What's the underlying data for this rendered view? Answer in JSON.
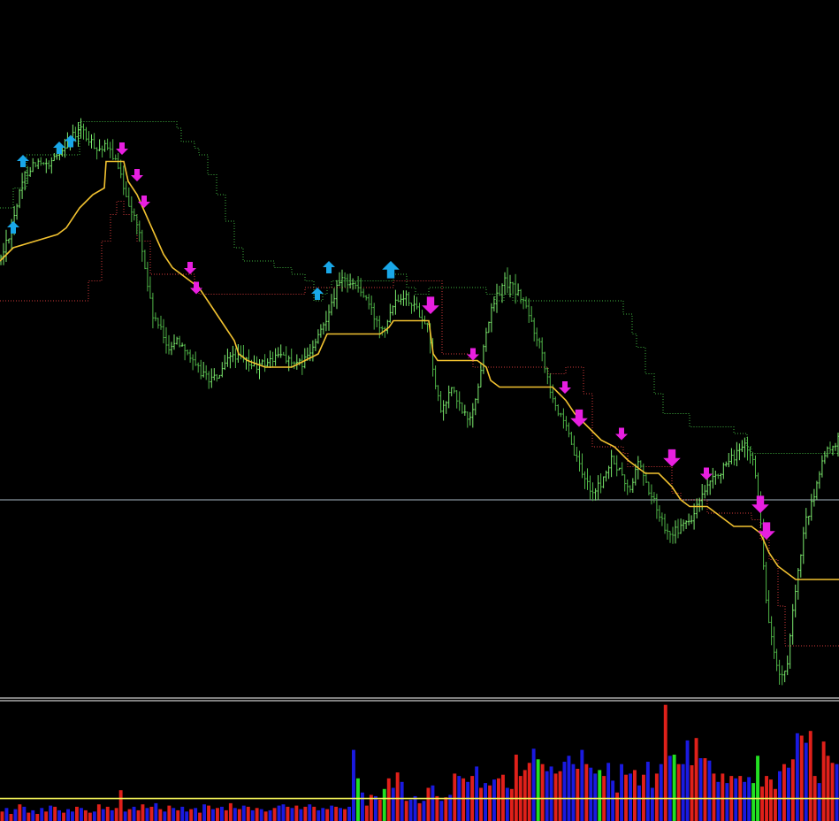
{
  "colors": {
    "background": "#000000",
    "price_bar": "#7CEB6E",
    "price_bar_dark": "#4FB548",
    "upper_channel": "#3FB53F",
    "lower_channel": "#D23A3A",
    "middle_line": "#F2C230",
    "horizontal_level": "#A9B8C4",
    "separator": "#FFFFFF",
    "arrow_up": "#19A7E8",
    "arrow_down": "#E81FE0",
    "volume_up": "#1A1AE0",
    "volume_down": "#E0201A",
    "volume_spike": "#22E022",
    "volume_average": "#F5F55A"
  },
  "chart_data": [
    {
      "type": "candlestick",
      "title": "",
      "xlabel": "",
      "ylabel": "",
      "ylim": [
        0,
        100
      ],
      "x_count": 190,
      "price_path": [
        [
          0,
          66
        ],
        [
          10,
          70
        ],
        [
          18,
          74
        ],
        [
          28,
          79
        ],
        [
          40,
          81
        ],
        [
          55,
          80
        ],
        [
          65,
          82
        ],
        [
          75,
          84
        ],
        [
          85,
          85
        ],
        [
          92,
          86
        ],
        [
          100,
          84
        ],
        [
          112,
          83
        ],
        [
          120,
          83
        ],
        [
          128,
          82
        ],
        [
          138,
          78
        ],
        [
          148,
          74
        ],
        [
          158,
          70
        ],
        [
          165,
          64
        ],
        [
          172,
          58
        ],
        [
          180,
          56
        ],
        [
          190,
          53
        ],
        [
          200,
          54
        ],
        [
          210,
          53
        ],
        [
          220,
          50
        ],
        [
          230,
          49
        ],
        [
          240,
          48
        ],
        [
          250,
          49
        ],
        [
          262,
          52
        ],
        [
          275,
          51
        ],
        [
          290,
          50
        ],
        [
          305,
          51
        ],
        [
          320,
          52
        ],
        [
          335,
          50
        ],
        [
          345,
          51
        ],
        [
          355,
          53
        ],
        [
          365,
          56
        ],
        [
          375,
          60
        ],
        [
          385,
          63
        ],
        [
          395,
          63
        ],
        [
          405,
          62
        ],
        [
          415,
          60
        ],
        [
          425,
          57
        ],
        [
          435,
          56
        ],
        [
          445,
          60
        ],
        [
          455,
          61
        ],
        [
          465,
          60
        ],
        [
          475,
          58
        ],
        [
          485,
          56
        ],
        [
          492,
          47
        ],
        [
          500,
          43
        ],
        [
          510,
          47
        ],
        [
          520,
          44
        ],
        [
          530,
          42
        ],
        [
          540,
          46
        ],
        [
          550,
          56
        ],
        [
          560,
          60
        ],
        [
          570,
          63
        ],
        [
          580,
          62
        ],
        [
          592,
          60
        ],
        [
          603,
          56
        ],
        [
          612,
          53
        ],
        [
          622,
          47
        ],
        [
          632,
          43
        ],
        [
          642,
          40
        ],
        [
          652,
          36
        ],
        [
          662,
          33
        ],
        [
          672,
          31
        ],
        [
          682,
          33
        ],
        [
          692,
          36
        ],
        [
          702,
          34
        ],
        [
          712,
          31
        ],
        [
          722,
          36
        ],
        [
          732,
          32
        ],
        [
          742,
          29
        ],
        [
          752,
          26
        ],
        [
          762,
          25
        ],
        [
          772,
          26
        ],
        [
          782,
          27
        ],
        [
          792,
          30
        ],
        [
          802,
          32
        ],
        [
          812,
          34
        ],
        [
          822,
          35
        ],
        [
          832,
          37
        ],
        [
          842,
          38
        ],
        [
          852,
          36
        ],
        [
          860,
          28
        ],
        [
          866,
          15
        ],
        [
          872,
          10
        ],
        [
          878,
          5
        ],
        [
          884,
          3
        ],
        [
          890,
          4
        ],
        [
          896,
          12
        ],
        [
          902,
          18
        ],
        [
          910,
          26
        ],
        [
          920,
          30
        ],
        [
          930,
          36
        ],
        [
          940,
          38
        ],
        [
          949,
          39
        ]
      ],
      "upper_channel": [
        [
          0,
          74
        ],
        [
          15,
          77
        ],
        [
          30,
          82
        ],
        [
          90,
          87
        ],
        [
          190,
          87
        ],
        [
          200,
          86
        ],
        [
          205,
          84
        ],
        [
          220,
          83
        ],
        [
          225,
          82
        ],
        [
          235,
          79
        ],
        [
          245,
          76
        ],
        [
          255,
          72
        ],
        [
          265,
          68
        ],
        [
          275,
          66
        ],
        [
          300,
          66
        ],
        [
          310,
          65
        ],
        [
          330,
          64
        ],
        [
          345,
          63
        ],
        [
          355,
          60
        ],
        [
          365,
          61
        ],
        [
          370,
          62
        ],
        [
          375,
          63
        ],
        [
          440,
          63
        ],
        [
          445,
          64
        ],
        [
          460,
          62
        ],
        [
          470,
          61
        ],
        [
          485,
          62
        ],
        [
          545,
          62
        ],
        [
          550,
          61
        ],
        [
          560,
          60
        ],
        [
          570,
          61
        ],
        [
          580,
          60
        ],
        [
          600,
          60
        ],
        [
          690,
          60
        ],
        [
          705,
          58
        ],
        [
          715,
          55
        ],
        [
          720,
          53
        ],
        [
          730,
          49
        ],
        [
          740,
          46
        ],
        [
          750,
          43
        ],
        [
          765,
          43
        ],
        [
          780,
          41
        ],
        [
          810,
          41
        ],
        [
          830,
          40
        ],
        [
          845,
          38
        ],
        [
          850,
          37
        ],
        [
          949,
          37
        ]
      ],
      "lower_channel": [
        [
          0,
          60
        ],
        [
          80,
          60
        ],
        [
          100,
          63
        ],
        [
          115,
          69
        ],
        [
          125,
          73
        ],
        [
          132,
          75
        ],
        [
          140,
          73
        ],
        [
          155,
          69
        ],
        [
          170,
          64
        ],
        [
          190,
          64
        ],
        [
          220,
          62
        ],
        [
          225,
          61
        ],
        [
          340,
          61
        ],
        [
          345,
          62
        ],
        [
          395,
          62
        ],
        [
          440,
          62
        ],
        [
          445,
          63
        ],
        [
          490,
          63
        ],
        [
          500,
          52
        ],
        [
          510,
          52
        ],
        [
          530,
          51
        ],
        [
          535,
          50
        ],
        [
          600,
          50
        ],
        [
          620,
          49
        ],
        [
          630,
          49
        ],
        [
          640,
          50
        ],
        [
          660,
          46
        ],
        [
          670,
          38
        ],
        [
          690,
          38
        ],
        [
          705,
          37
        ],
        [
          710,
          35
        ],
        [
          750,
          35
        ],
        [
          760,
          31
        ],
        [
          770,
          30
        ],
        [
          790,
          30
        ],
        [
          800,
          28
        ],
        [
          840,
          28
        ],
        [
          850,
          27
        ],
        [
          860,
          24
        ],
        [
          870,
          21
        ],
        [
          880,
          14
        ],
        [
          888,
          8
        ],
        [
          949,
          8
        ]
      ],
      "middle_line": [
        [
          0,
          66
        ],
        [
          15,
          68
        ],
        [
          40,
          69
        ],
        [
          65,
          70
        ],
        [
          75,
          71
        ],
        [
          90,
          74
        ],
        [
          105,
          76
        ],
        [
          118,
          77
        ],
        [
          120,
          81
        ],
        [
          140,
          81
        ],
        [
          145,
          78
        ],
        [
          155,
          76
        ],
        [
          165,
          73
        ],
        [
          175,
          70
        ],
        [
          185,
          67
        ],
        [
          195,
          65
        ],
        [
          205,
          64
        ],
        [
          215,
          63
        ],
        [
          225,
          62
        ],
        [
          235,
          60
        ],
        [
          245,
          58
        ],
        [
          255,
          56
        ],
        [
          265,
          54
        ],
        [
          270,
          52
        ],
        [
          280,
          51
        ],
        [
          300,
          50
        ],
        [
          315,
          50
        ],
        [
          330,
          50
        ],
        [
          345,
          51
        ],
        [
          360,
          52
        ],
        [
          370,
          55
        ],
        [
          380,
          55
        ],
        [
          430,
          55
        ],
        [
          440,
          56
        ],
        [
          445,
          57
        ],
        [
          485,
          57
        ],
        [
          490,
          52
        ],
        [
          495,
          51
        ],
        [
          540,
          51
        ],
        [
          550,
          50
        ],
        [
          555,
          48
        ],
        [
          565,
          47
        ],
        [
          610,
          47
        ],
        [
          625,
          47
        ],
        [
          640,
          45
        ],
        [
          650,
          43
        ],
        [
          665,
          41
        ],
        [
          680,
          39
        ],
        [
          695,
          38
        ],
        [
          710,
          36
        ],
        [
          720,
          35
        ],
        [
          730,
          34
        ],
        [
          745,
          34
        ],
        [
          760,
          32
        ],
        [
          770,
          30
        ],
        [
          780,
          29
        ],
        [
          800,
          29
        ],
        [
          810,
          28
        ],
        [
          820,
          27
        ],
        [
          830,
          26
        ],
        [
          850,
          26
        ],
        [
          860,
          25
        ],
        [
          870,
          22
        ],
        [
          880,
          20
        ],
        [
          890,
          19
        ],
        [
          900,
          18
        ],
        [
          910,
          18
        ],
        [
          949,
          18
        ]
      ],
      "horizontal_level": 30,
      "arrows_up": [
        [
          15,
          72
        ],
        [
          26,
          82
        ],
        [
          67,
          84
        ],
        [
          80,
          85
        ],
        [
          359,
          62
        ],
        [
          372,
          66
        ],
        [
          442,
          66
        ]
      ],
      "arrows_down": [
        [
          138,
          82
        ],
        [
          155,
          78
        ],
        [
          163,
          74
        ],
        [
          215,
          64
        ],
        [
          222,
          61
        ],
        [
          487,
          58
        ],
        [
          535,
          51
        ],
        [
          639,
          46
        ],
        [
          655,
          41
        ],
        [
          703,
          39
        ],
        [
          760,
          35
        ],
        [
          799,
          33
        ],
        [
          860,
          28
        ],
        [
          867,
          24
        ]
      ]
    },
    {
      "type": "bar",
      "title": "",
      "xlabel": "",
      "ylabel": "",
      "ylim": [
        0,
        100
      ],
      "average_level": 19,
      "values": [
        8,
        11,
        6,
        10,
        14,
        12,
        7,
        9,
        6,
        11,
        8,
        13,
        12,
        9,
        7,
        10,
        8,
        12,
        11,
        9,
        7,
        8,
        14,
        10,
        12,
        9,
        11,
        26,
        8,
        10,
        12,
        9,
        14,
        11,
        12,
        15,
        10,
        8,
        13,
        11,
        9,
        12,
        8,
        10,
        11,
        7,
        14,
        13,
        10,
        11,
        12,
        9,
        15,
        11,
        10,
        13,
        12,
        9,
        11,
        10,
        8,
        9,
        11,
        13,
        14,
        12,
        11,
        13,
        10,
        12,
        14,
        12,
        9,
        11,
        10,
        13,
        12,
        11,
        10,
        12,
        60,
        36,
        24,
        13,
        22,
        21,
        18,
        27,
        36,
        28,
        41,
        33,
        17,
        18,
        21,
        15,
        17,
        28,
        30,
        21,
        17,
        20,
        22,
        40,
        38,
        36,
        33,
        38,
        46,
        28,
        32,
        30,
        35,
        36,
        39,
        28,
        27,
        56,
        38,
        43,
        49,
        61,
        52,
        48,
        42,
        46,
        40,
        42,
        50,
        55,
        48,
        44,
        60,
        48,
        45,
        40,
        43,
        38,
        49,
        34,
        24,
        48,
        39,
        40,
        43,
        30,
        39,
        50,
        28,
        40,
        48,
        98,
        55,
        56,
        48,
        48,
        68,
        47,
        70,
        53,
        53,
        51,
        40,
        33,
        40,
        32,
        38,
        36,
        38,
        33,
        37,
        32,
        55,
        29,
        38,
        35,
        27,
        42,
        48,
        45,
        52,
        74,
        72,
        66,
        76,
        38,
        32,
        67,
        55,
        49,
        48
      ],
      "colors": [
        "d",
        "u",
        "d",
        "u",
        "d",
        "u",
        "d",
        "u",
        "d",
        "u",
        "d",
        "u",
        "d",
        "u",
        "d",
        "u",
        "u",
        "d",
        "u",
        "d",
        "d",
        "u",
        "d",
        "u",
        "d",
        "u",
        "d",
        "d",
        "u",
        "d",
        "u",
        "d",
        "d",
        "u",
        "d",
        "u",
        "d",
        "u",
        "d",
        "u",
        "d",
        "u",
        "u",
        "d",
        "u",
        "d",
        "u",
        "d",
        "u",
        "d",
        "u",
        "d",
        "d",
        "u",
        "d",
        "u",
        "d",
        "u",
        "d",
        "u",
        "d",
        "u",
        "d",
        "u",
        "u",
        "d",
        "u",
        "d",
        "u",
        "d",
        "u",
        "d",
        "u",
        "u",
        "d",
        "u",
        "d",
        "u",
        "d",
        "u",
        "u",
        "s",
        "u",
        "d",
        "d",
        "u",
        "d",
        "s",
        "d",
        "u",
        "d",
        "u",
        "d",
        "u",
        "u",
        "d",
        "u",
        "d",
        "u",
        "d",
        "u",
        "d",
        "u",
        "d",
        "u",
        "d",
        "u",
        "d",
        "u",
        "d",
        "u",
        "d",
        "u",
        "d",
        "d",
        "u",
        "d",
        "d",
        "d",
        "d",
        "d",
        "u",
        "s",
        "d",
        "u",
        "u",
        "d",
        "d",
        "u",
        "u",
        "u",
        "d",
        "u",
        "d",
        "u",
        "u",
        "s",
        "d",
        "u",
        "u",
        "d",
        "u",
        "d",
        "u",
        "d",
        "u",
        "d",
        "u",
        "u",
        "d",
        "u",
        "d",
        "u",
        "s",
        "d",
        "u",
        "u",
        "d",
        "d",
        "u",
        "d",
        "u",
        "d",
        "u",
        "d",
        "u",
        "d",
        "u",
        "d",
        "u",
        "u",
        "s",
        "s",
        "d",
        "d",
        "d",
        "d",
        "u",
        "d",
        "u",
        "d",
        "u",
        "d",
        "u",
        "d",
        "d",
        "u",
        "d",
        "d",
        "d",
        "u"
      ]
    }
  ]
}
